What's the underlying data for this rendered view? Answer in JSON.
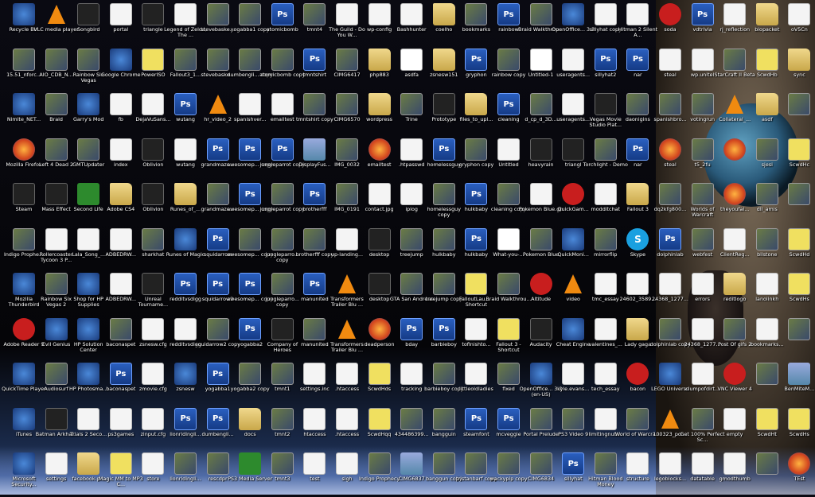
{
  "desktop": {
    "columns": [
      [
        [
          "Recycle Bin",
          "app"
        ],
        [
          "15.51_nforc...",
          "img"
        ],
        [
          "Nimite_NET...",
          "app"
        ],
        [
          "Mozilla Firefox",
          "ff"
        ],
        [
          "Steam",
          "dark"
        ],
        [
          "Indigo Prophe...",
          "img"
        ],
        [
          "Mozilla Thunderbird",
          "app"
        ],
        [
          "Adobe Reader 9",
          "red"
        ],
        [
          "QuickTime Player",
          "app"
        ],
        [
          "iTunes",
          "app"
        ],
        [
          "Microsoft Security...",
          "app"
        ]
      ],
      [
        [
          "VLC media player",
          "vlc"
        ],
        [
          "AIO_CDB_N...",
          "img"
        ],
        [
          "Braid",
          "img"
        ],
        [
          "Left 4 Dead 2",
          "img"
        ],
        [
          "Mass Effect",
          "dark"
        ],
        [
          "Rollercoaster Tycoon 3 P...",
          "doc"
        ],
        [
          "Rainbow Six Vegas 2",
          "img"
        ],
        [
          "Evil Genius",
          "app"
        ],
        [
          "Audiosurf",
          "img"
        ],
        [
          "Batman Arkha...",
          "dark"
        ],
        [
          "settings",
          "doc"
        ]
      ],
      [
        [
          "Songbird",
          "dark"
        ],
        [
          "Rainbow Six Vegas",
          "img"
        ],
        [
          "Garry's Mod",
          "app"
        ],
        [
          "GMTUpdater",
          "img"
        ],
        [
          "Second Life",
          "green"
        ],
        [
          "Lala_Song_...",
          "doc"
        ],
        [
          "Shop for HP Supplies",
          "app"
        ],
        [
          "HP Solution Center",
          "app"
        ],
        [
          "HP Photosma...",
          "app"
        ],
        [
          "Trials 2 Seco...",
          "doc"
        ],
        [
          "facebook-p...",
          "folder"
        ]
      ],
      [
        [
          "portal",
          "doc"
        ],
        [
          "Google Chrome",
          "app"
        ],
        [
          "fb",
          "doc"
        ],
        [
          "index",
          "doc"
        ],
        [
          "Adobe CS4",
          "folder"
        ],
        [
          "ADBEDRW...",
          "doc"
        ],
        [
          "ADBEDRW...",
          "doc"
        ],
        [
          "baconaspet",
          "img"
        ],
        [
          "baconaspet",
          "ps"
        ],
        [
          "ps3games",
          "doc"
        ],
        [
          "Magic MM to MP3 C...",
          "yellow"
        ]
      ],
      [
        [
          "triangle",
          "dark"
        ],
        [
          "PowerISO",
          "yellow"
        ],
        [
          "DejaVuSans...",
          "doc"
        ],
        [
          "Oblivion",
          "dark"
        ],
        [
          "Oblivion",
          "dark"
        ],
        [
          "sharkhat",
          "img"
        ],
        [
          "Unreal Tourname...",
          "dark"
        ],
        [
          "zsnesw.cfg",
          "doc"
        ],
        [
          "zmovie.cfg",
          "doc"
        ],
        [
          "zinput.cfg",
          "doc"
        ],
        [
          "store",
          "doc"
        ]
      ],
      [
        [
          "Legend of Zelda, The ...",
          "doc"
        ],
        [
          "Fallout3_1...",
          "img"
        ],
        [
          "wutang",
          "ps"
        ],
        [
          "wutang",
          "doc"
        ],
        [
          "Runes_of_...",
          "folder"
        ],
        [
          "Runes of Magic",
          "app"
        ],
        [
          "redditvsdigg",
          "ps"
        ],
        [
          "redditvsdigg",
          "doc"
        ],
        [
          "zsnesw",
          "app"
        ],
        [
          "lionridingli...",
          "ps"
        ],
        [
          "lionridingli...",
          "img"
        ]
      ],
      [
        [
          "stevebaske...",
          "img"
        ],
        [
          "stevebaske...",
          "img"
        ],
        [
          "hr_video_2",
          "vlc"
        ],
        [
          "grandmazo...",
          "ps"
        ],
        [
          "grandmazo...",
          "img"
        ],
        [
          "squidarrow",
          "ps"
        ],
        [
          "squidarrow2",
          "ps"
        ],
        [
          "squidarrow2 copy",
          "img"
        ],
        [
          "yogabba1",
          "ps"
        ],
        [
          "dumbengli...",
          "ps"
        ],
        [
          "rescdpr",
          "img"
        ]
      ],
      [
        [
          "yogabba1 copy",
          "img"
        ],
        [
          "dumbengli... copy",
          "img"
        ],
        [
          "spanishver...",
          "doc"
        ],
        [
          "awesomep... copy",
          "ps"
        ],
        [
          "awesomep... copy",
          "ps"
        ],
        [
          "awesomep... copy",
          "img"
        ],
        [
          "awesomep... copy",
          "ps"
        ],
        [
          "yogabba2",
          "ps"
        ],
        [
          "yogabba2 copy",
          "img"
        ],
        [
          "docs",
          "folder"
        ],
        [
          "PS3 Media Server",
          "green"
        ]
      ],
      [
        [
          "atomicbomb",
          "ps"
        ],
        [
          "atomicbomb copy",
          "img"
        ],
        [
          "emailtest",
          "doc"
        ],
        [
          "jungleparrot copy",
          "ps"
        ],
        [
          "jungleparrot copy",
          "img"
        ],
        [
          "jungleparro... copy",
          "img"
        ],
        [
          "jungleparro... copy",
          "img"
        ],
        [
          "Company of Heroes",
          "dark"
        ],
        [
          "tmnt1",
          "img"
        ],
        [
          "tmnt2",
          "img"
        ],
        [
          "tmnt3",
          "img"
        ]
      ],
      [
        [
          "tmnt4",
          "img"
        ],
        [
          "tmntshirt",
          "ps"
        ],
        [
          "tmntshirt copy",
          "img"
        ],
        [
          "DisplayFus...",
          "sky"
        ],
        [
          "brotherfff",
          "ps"
        ],
        [
          "brotherfff copy",
          "img"
        ],
        [
          "manunited",
          "ps"
        ],
        [
          "manunited",
          "img"
        ],
        [
          "settings.inc",
          "doc"
        ],
        [
          "htaccess",
          "doc"
        ],
        [
          "test",
          "doc"
        ]
      ],
      [
        [
          "The Guild - Do You W...",
          "doc"
        ],
        [
          "CIMG6417",
          "img"
        ],
        [
          "CIMG6570",
          "img"
        ],
        [
          "IMG_0032",
          "img"
        ],
        [
          "IMG_0191",
          "img"
        ],
        [
          "up-landing...",
          "doc"
        ],
        [
          "Transformers Trailer Blu ...",
          "vlc"
        ],
        [
          "Transformers Trailer Blu ...",
          "vlc"
        ],
        [
          ".htaccess",
          "doc"
        ],
        [
          ".htaccess",
          "doc"
        ],
        [
          "sigh",
          "doc"
        ]
      ],
      [
        [
          "wp-config",
          "doc"
        ],
        [
          "php883",
          "folder"
        ],
        [
          "wordpress",
          "folder"
        ],
        [
          "emailtest",
          "ff"
        ],
        [
          "contact.jpg",
          "doc"
        ],
        [
          "desktop",
          "dark"
        ],
        [
          "desktop",
          "dark"
        ],
        [
          "deadperson",
          "ff"
        ],
        [
          "ScwdHds",
          "yellow"
        ],
        [
          "ScwdHqq",
          "yellow"
        ],
        [
          "Indigo Prophecy",
          "img"
        ]
      ],
      [
        [
          "Bashhunter",
          "doc"
        ],
        [
          "asdfa",
          "txt"
        ],
        [
          "Trine",
          "img"
        ],
        [
          ".htpasswd",
          "doc"
        ],
        [
          "iplog",
          "doc"
        ],
        [
          "treejump",
          "img"
        ],
        [
          "GTA San Andreas",
          "img"
        ],
        [
          "bday",
          "ps"
        ],
        [
          "tracking",
          "doc"
        ],
        [
          "434486399...",
          "img"
        ],
        [
          "CIMG6837",
          "sky"
        ]
      ],
      [
        [
          "coelho",
          "folder"
        ],
        [
          "zsnesw151",
          "folder"
        ],
        [
          "Prototype",
          "dark"
        ],
        [
          "homelessguy",
          "ps"
        ],
        [
          "homelessguy copy",
          "img"
        ],
        [
          "hulkbaby",
          "img"
        ],
        [
          "treejump copy",
          "img"
        ],
        [
          "barbieboy",
          "ps"
        ],
        [
          "barbieboy copy",
          "img"
        ],
        [
          "bangguin",
          "img"
        ],
        [
          "banggun copy",
          "img"
        ]
      ],
      [
        [
          "bookmarks",
          "img"
        ],
        [
          "gryphon",
          "ps"
        ],
        [
          "files_to_upl...",
          "folder"
        ],
        [
          "gryphon copy",
          "img"
        ],
        [
          "hulkbaby",
          "ps"
        ],
        [
          "hulkbaby",
          "ps"
        ],
        [
          "FalloutLau... - Shortcut",
          "yellow"
        ],
        [
          "tofinishto...",
          "doc"
        ],
        [
          "littleoldladies",
          "doc"
        ],
        [
          "steamfont",
          "ps"
        ],
        [
          "tristanbarf copy",
          "img"
        ]
      ],
      [
        [
          "rainbow",
          "ps"
        ],
        [
          "rainbow copy",
          "img"
        ],
        [
          "cleaning",
          "ps"
        ],
        [
          "Untitled",
          "doc"
        ],
        [
          "cleaning copy",
          "img"
        ],
        [
          "What-you-...",
          "txt"
        ],
        [
          "Braid Walkthrou...",
          "img"
        ],
        [
          "Fallout 3 - Shortcut",
          "yellow"
        ],
        [
          "fixed",
          "img"
        ],
        [
          "mcveggie",
          "ps"
        ],
        [
          "wackypip copy",
          "img"
        ]
      ],
      [
        [
          "Braid Walkthrou...",
          "img"
        ],
        [
          "Untitled-1",
          "txt"
        ],
        [
          "d_cp_d_3D...",
          "img"
        ],
        [
          "heavyrain",
          "dark"
        ],
        [
          "Pokemon Blue.gb",
          "doc"
        ],
        [
          "Pokemon Blue",
          "img"
        ],
        [
          "Altitude",
          "red"
        ],
        [
          "Audacity",
          "dark"
        ],
        [
          "OpenOffice... 3.2 (en-US)",
          "app"
        ],
        [
          "Portal Prelude",
          "img"
        ],
        [
          "CIMG6834",
          "img"
        ]
      ],
      [
        [
          "OpenOffice... 3.2",
          "app"
        ],
        [
          "useragents...",
          "doc"
        ],
        [
          "useragents...",
          "doc"
        ],
        [
          "triangl",
          "dark"
        ],
        [
          "QuickGam...",
          "red"
        ],
        [
          "QuickMoni...",
          "app"
        ],
        [
          "video",
          "vlc"
        ],
        [
          "Cheat Engine",
          "app"
        ],
        [
          "kyle.evans...",
          "doc"
        ],
        [
          "PS3 Video 9",
          "img"
        ],
        [
          "sillyhat",
          "ps"
        ]
      ],
      [
        [
          "sillyhat copy",
          "doc"
        ],
        [
          "sillyhat2",
          "ps"
        ],
        [
          "Vegas Movie Studio Plat...",
          "dark"
        ],
        [
          "Torchlight - Demo",
          "img"
        ],
        [
          "modditchat",
          "doc"
        ],
        [
          "mirrorflip",
          "img"
        ],
        [
          "tmc_essay",
          "doc"
        ],
        [
          "valentines_...",
          "doc"
        ],
        [
          "tech_essay",
          "doc"
        ],
        [
          "limitingnutr...",
          "doc"
        ],
        [
          "Hitman Blood Money",
          "img"
        ]
      ],
      [
        [
          "Hitman 2 Silent A...",
          "doc"
        ],
        [
          "nar",
          "ps"
        ],
        [
          "daonigins",
          "img"
        ],
        [
          "nar",
          "ps"
        ],
        [
          "Fallout 3",
          "folder"
        ],
        [
          "Skype",
          "skype"
        ],
        [
          "24602_3589...",
          "doc"
        ],
        [
          "Lady gaga",
          "folder"
        ],
        [
          "bacon",
          "red"
        ],
        [
          "World of Warcra...",
          "img"
        ],
        [
          "structure",
          "doc"
        ]
      ],
      [
        [
          "soda",
          "red"
        ],
        [
          "steal",
          "doc"
        ],
        [
          "spanishbro...",
          "img"
        ],
        [
          "steal",
          "ff"
        ],
        [
          "dq2kfg800...",
          "img"
        ],
        [
          "dolphinlab",
          "ps"
        ],
        [
          "24368_1277...",
          "doc"
        ],
        [
          "dolphinlab copy",
          "img"
        ],
        [
          "LEGO Universe",
          "app"
        ],
        [
          "100323_poi...",
          "vlc"
        ],
        [
          "legoblocks...",
          "doc"
        ]
      ],
      [
        [
          "vdtrivia",
          "ps"
        ],
        [
          "wp.unitel",
          "doc"
        ],
        [
          "votingrun",
          "img"
        ],
        [
          "t5_2fu",
          "img"
        ],
        [
          "Worlds of Warcraft",
          "img"
        ],
        [
          "webfest",
          "img"
        ],
        [
          "errors",
          "doc"
        ],
        [
          "24368_1277...",
          "doc"
        ],
        [
          "clumpofdirt...",
          "doc"
        ],
        [
          "Get 100% Perfect Sc...",
          "img"
        ],
        [
          "datatable",
          "doc"
        ]
      ],
      [
        [
          "rj_reflection",
          "doc"
        ],
        [
          "StarCraft II Beta",
          "img"
        ],
        [
          "Collateral_...",
          "vlc"
        ],
        [
          "",
          "ff"
        ],
        [
          "theyoufai...",
          "ff"
        ],
        [
          "ClientReg...",
          "doc"
        ],
        [
          "reditlogo",
          "folder"
        ],
        [
          "Post Of gifs 2",
          "img"
        ],
        [
          "VNC Viewer 4",
          "red"
        ],
        [
          "empty",
          "doc"
        ],
        [
          "gmodthumb",
          "doc"
        ]
      ],
      [
        [
          "biopacket",
          "folder"
        ],
        [
          "ScwdHb",
          "yellow"
        ],
        [
          "asdf",
          "folder"
        ],
        [
          "sjesi",
          "img"
        ],
        [
          "dll_amis",
          "img"
        ],
        [
          "bilstone",
          "img"
        ],
        [
          "lanolinkh",
          "doc"
        ],
        [
          "bookmarks...",
          "doc"
        ],
        [
          "",
          "img"
        ],
        [
          "ScwdHt",
          "yellow"
        ],
        [
          "",
          "img"
        ]
      ],
      [
        [
          "oV5Cn",
          "doc"
        ],
        [
          "sync",
          "folder"
        ],
        [
          "",
          "img"
        ],
        [
          "ScwdHc",
          "yellow"
        ],
        [
          "",
          "img"
        ],
        [
          "ScwdHd",
          "yellow"
        ],
        [
          "ScwdHs",
          "yellow"
        ],
        [
          "",
          "img"
        ],
        [
          "BenMiteM...",
          "sky"
        ],
        [
          "ScwdHs",
          "yellow"
        ],
        [
          "TEst",
          "ff"
        ]
      ]
    ]
  }
}
